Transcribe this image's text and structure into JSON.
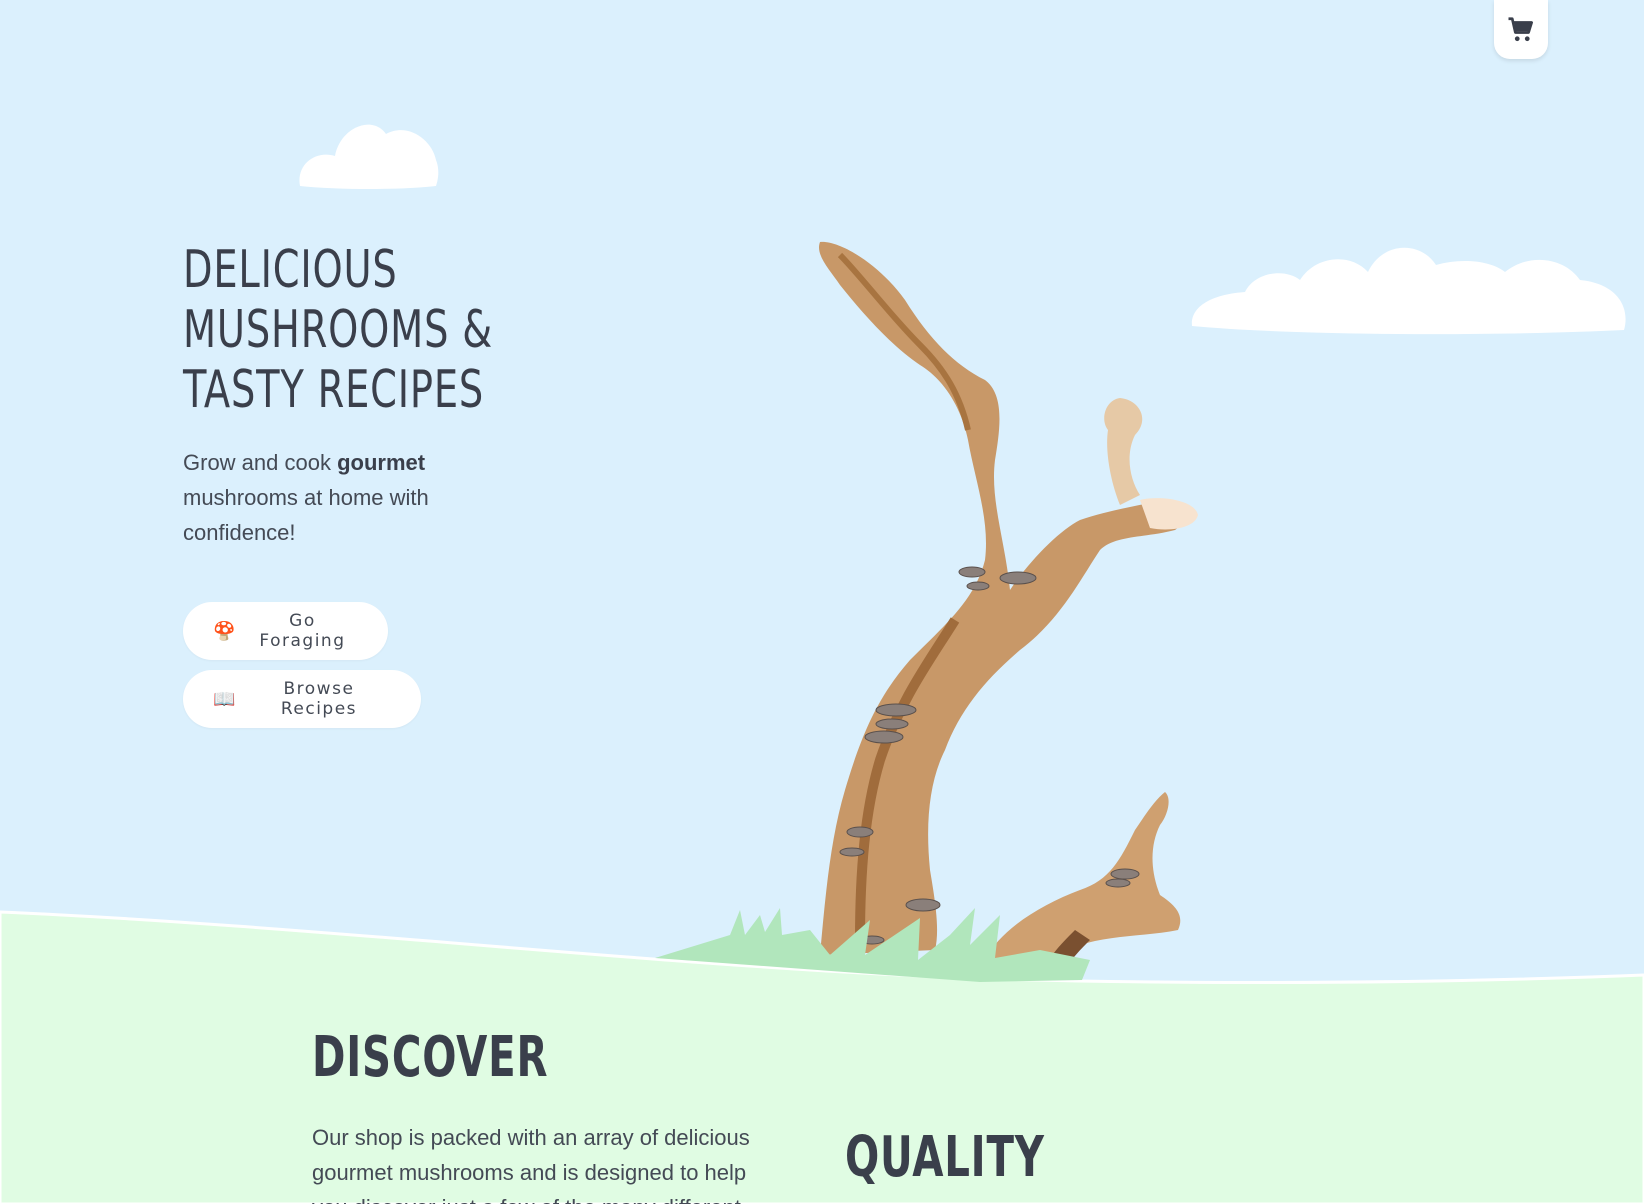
{
  "cart": {
    "icon": "cart-icon"
  },
  "hero": {
    "title_lines": [
      "Delicious",
      "Mushrooms &",
      "Tasty Recipes"
    ],
    "subtitle_before": "Grow and cook ",
    "subtitle_bold": "gourmet",
    "subtitle_after": " mushrooms at home with confidence!"
  },
  "buttons": {
    "forage": {
      "emoji": "🍄",
      "label": "Go Foraging"
    },
    "recipes": {
      "emoji": "📖",
      "label": "Browse Recipes"
    }
  },
  "discover": {
    "title": "Discover",
    "body": "Our shop is packed with an array of delicious gourmet mushrooms and is designed to help you discover just a few of the many different"
  },
  "quality": {
    "title": "Quality"
  },
  "colors": {
    "sky": "#dbf0fd",
    "grass": "#e0fce3",
    "text": "#3a3f4b",
    "bark": "#c89868",
    "cloud": "#ffffff"
  }
}
